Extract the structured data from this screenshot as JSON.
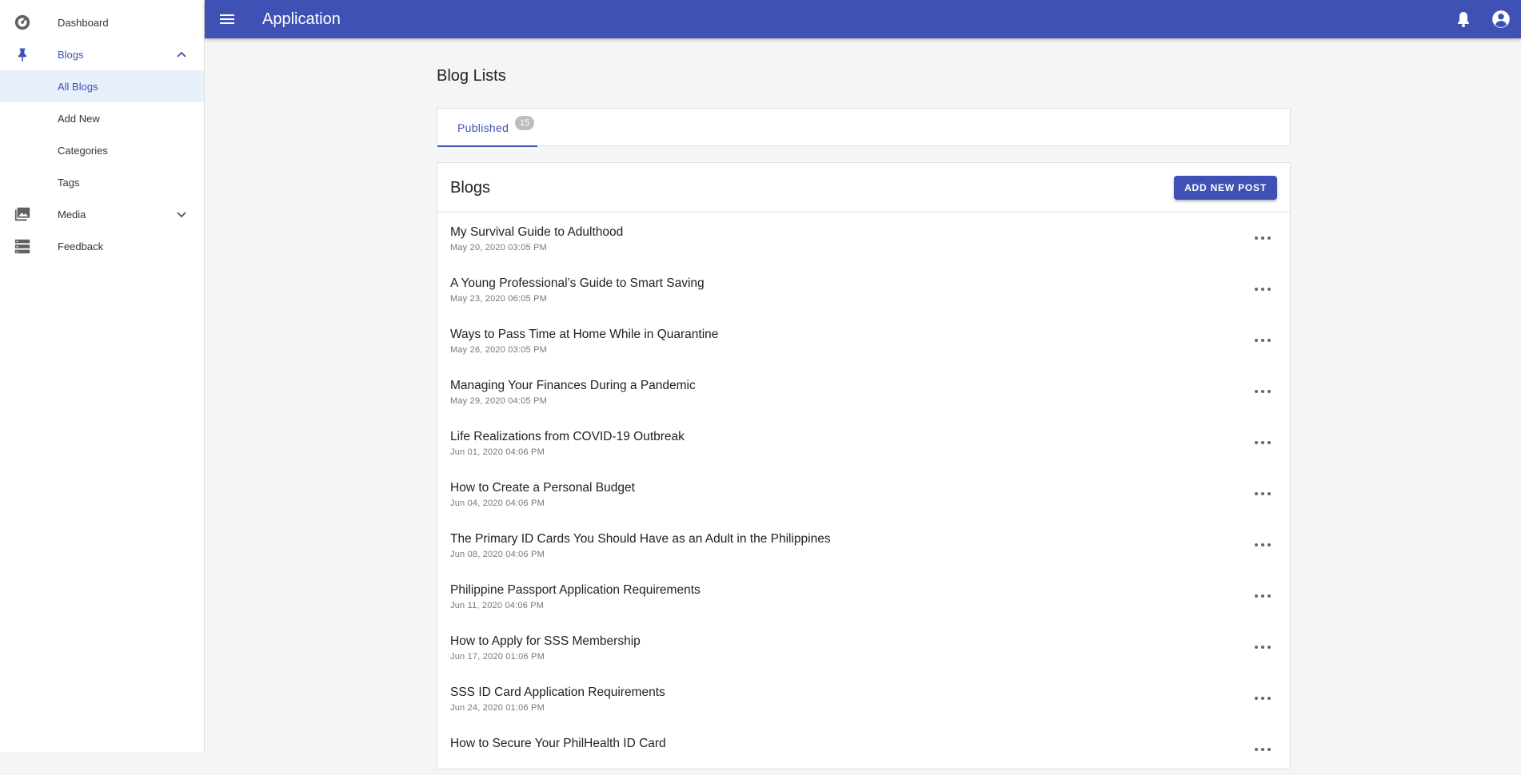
{
  "sidebar": {
    "items": [
      {
        "label": "Dashboard",
        "icon": "dashboard-icon"
      },
      {
        "label": "Blogs",
        "icon": "pin-icon",
        "expanded": true,
        "children": [
          {
            "label": "All Blogs",
            "selected": true
          },
          {
            "label": "Add New"
          },
          {
            "label": "Categories"
          },
          {
            "label": "Tags"
          }
        ]
      },
      {
        "label": "Media",
        "icon": "photo-library-icon",
        "expanded": false
      },
      {
        "label": "Feedback",
        "icon": "storage-icon"
      }
    ]
  },
  "appbar": {
    "title": "Application",
    "icons": [
      "menu-icon",
      "bell-icon",
      "account-icon"
    ]
  },
  "main": {
    "page_title": "Blog Lists",
    "tabs": [
      {
        "label": "Published",
        "badge": "15"
      }
    ],
    "card": {
      "title": "Blogs",
      "add_button": "ADD NEW POST",
      "posts": [
        {
          "title": "My Survival Guide to Adulthood",
          "date": "May 20, 2020 03:05 PM"
        },
        {
          "title": "A Young Professional’s Guide to Smart Saving",
          "date": "May 23, 2020 06:05 PM"
        },
        {
          "title": "Ways to Pass Time at Home While in Quarantine",
          "date": "May 26, 2020 03:05 PM"
        },
        {
          "title": "Managing Your Finances During a Pandemic",
          "date": "May 29, 2020 04:05 PM"
        },
        {
          "title": "Life Realizations from COVID-19 Outbreak",
          "date": "Jun 01, 2020 04:06 PM"
        },
        {
          "title": "How to Create a Personal Budget",
          "date": "Jun 04, 2020 04:06 PM"
        },
        {
          "title": "The Primary ID Cards You Should Have as an Adult in the Philippines",
          "date": "Jun 08, 2020 04:06 PM"
        },
        {
          "title": "Philippine Passport Application Requirements",
          "date": "Jun 11, 2020 04:06 PM"
        },
        {
          "title": "How to Apply for SSS Membership",
          "date": "Jun 17, 2020 01:06 PM"
        },
        {
          "title": "SSS ID Card Application Requirements",
          "date": "Jun 24, 2020 01:06 PM"
        },
        {
          "title": "How to Secure Your PhilHealth ID Card",
          "date": ""
        }
      ]
    }
  },
  "colors": {
    "primary": "#3f51b5",
    "selected_bg": "#e8f0fb",
    "badge": "#bdbdbd"
  }
}
